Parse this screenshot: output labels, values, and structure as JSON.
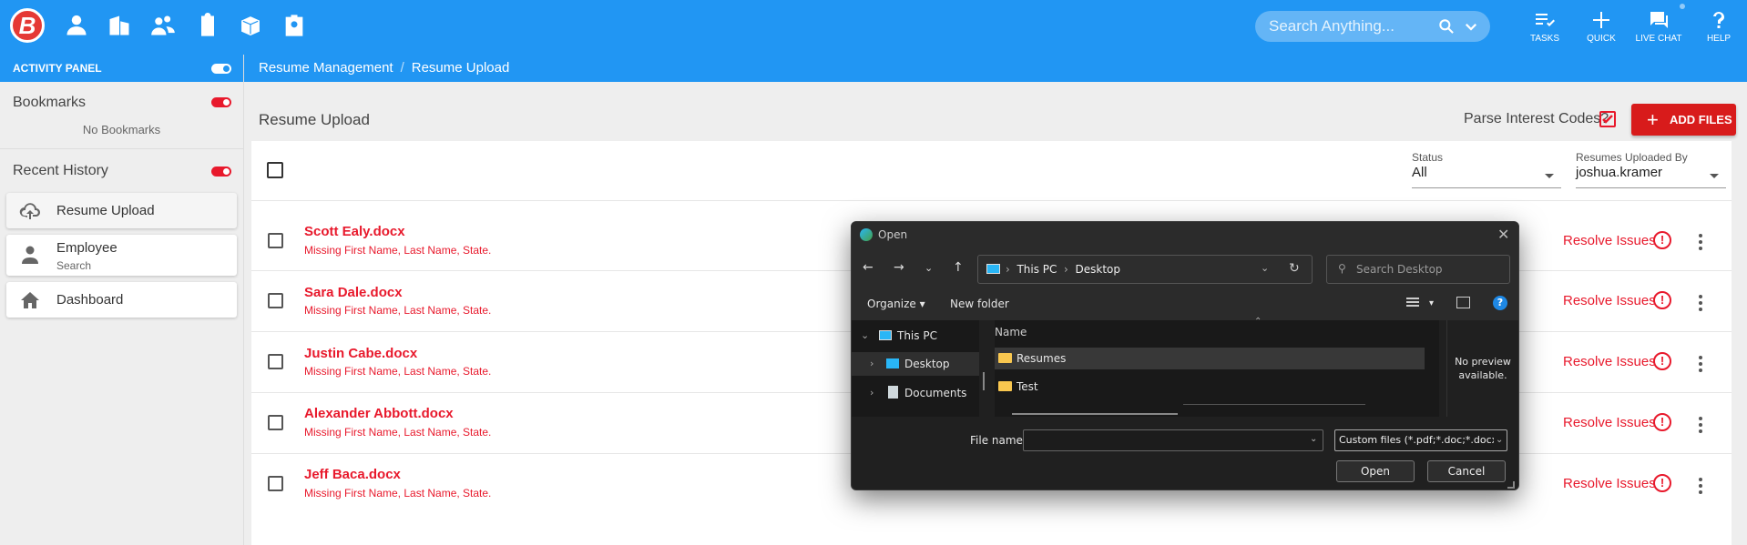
{
  "header": {
    "logo_text": "B",
    "nav_icons": [
      "person-icon",
      "building-icon",
      "people-icon",
      "clipboard-icon",
      "box-icon",
      "badge-icon"
    ],
    "search": {
      "placeholder": "Search Anything..."
    },
    "actions": [
      {
        "label": "TASKS",
        "icon": "tasks-icon"
      },
      {
        "label": "QUICK",
        "icon": "plus-icon"
      },
      {
        "label": "LIVE CHAT",
        "icon": "chat-icon"
      },
      {
        "label": "HELP",
        "icon": "help-icon"
      }
    ]
  },
  "breadcrumb": {
    "items": [
      "Resume Management",
      "Resume Upload"
    ],
    "separator": "/"
  },
  "sidebar": {
    "activity_panel_label": "ACTIVITY PANEL",
    "bookmarks_title": "Bookmarks",
    "no_bookmarks": "No Bookmarks",
    "recent_history_title": "Recent History",
    "history": [
      {
        "label": "Resume Upload",
        "sub": "",
        "icon": "cloud-upload-icon"
      },
      {
        "label": "Employee",
        "sub": "Search",
        "icon": "person-icon"
      },
      {
        "label": "Dashboard",
        "sub": "",
        "icon": "home-icon"
      }
    ]
  },
  "main": {
    "title": "Resume Upload",
    "parse_label": "Parse Interest Codes?",
    "parse_checked": true,
    "add_files_label": "ADD FILES",
    "filters": {
      "status_label": "Status",
      "status_value": "All",
      "uploaded_by_label": "Resumes Uploaded By",
      "uploaded_by_value": "joshua.kramer"
    },
    "rows": [
      {
        "name": "Scott Ealy.docx",
        "error": "Missing First Name, Last Name, State.",
        "action": "Resolve Issues"
      },
      {
        "name": "Sara Dale.docx",
        "error": "Missing First Name, Last Name, State.",
        "action": "Resolve Issues"
      },
      {
        "name": "Justin Cabe.docx",
        "error": "Missing First Name, Last Name, State.",
        "action": "Resolve Issues"
      },
      {
        "name": "Alexander Abbott.docx",
        "error": "Missing First Name, Last Name, State.",
        "action": "Resolve Issues"
      },
      {
        "name": "Jeff Baca.docx",
        "error": "Missing First Name, Last Name, State.",
        "action": "Resolve Issues"
      }
    ]
  },
  "dialog": {
    "title": "Open",
    "path": [
      "This PC",
      "Desktop"
    ],
    "search_placeholder": "Search Desktop",
    "organize_label": "Organize",
    "new_folder_label": "New folder",
    "tree": [
      {
        "label": "This PC",
        "expanded": true
      },
      {
        "label": "Desktop",
        "selected": true
      },
      {
        "label": "Documents"
      }
    ],
    "column_name": "Name",
    "files": [
      {
        "label": "Resumes",
        "selected": true
      },
      {
        "label": "Test"
      }
    ],
    "preview_text": "No preview available.",
    "file_name_label": "File name:",
    "file_name_value": "",
    "file_type": "Custom files (*.pdf;*.doc;*.docx)",
    "open_label": "Open",
    "cancel_label": "Cancel"
  },
  "colors": {
    "primary": "#2196f3",
    "accent_red": "#e8192c",
    "dialog_bg": "#202020"
  }
}
